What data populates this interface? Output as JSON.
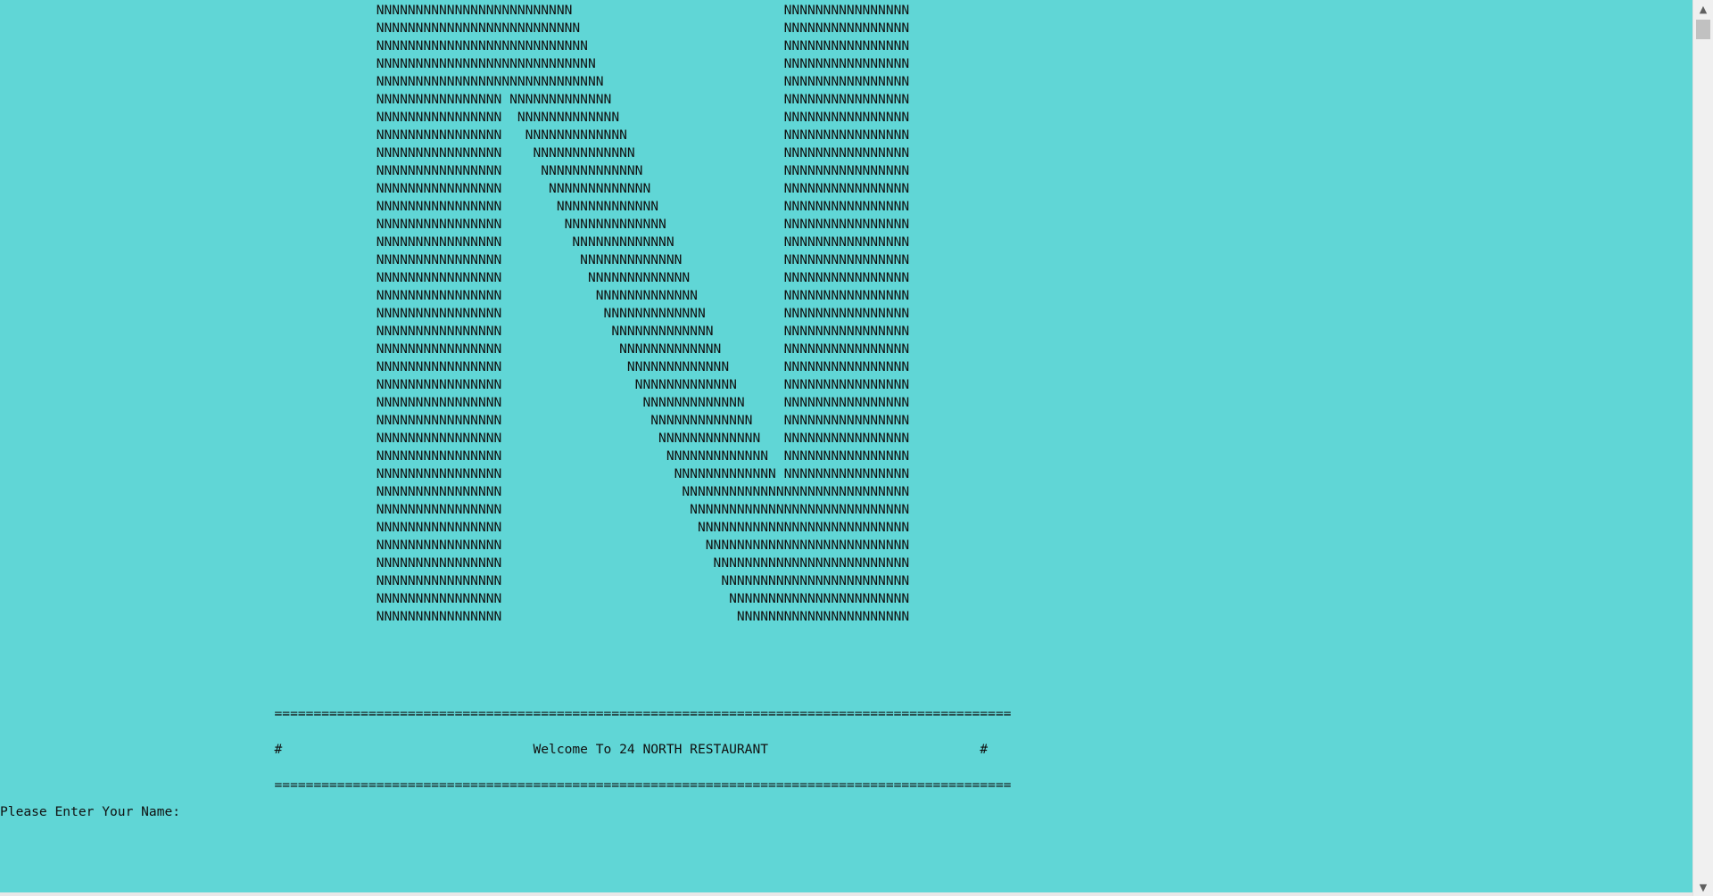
{
  "console": {
    "art_lines": [
      "                                                NNNNNNNNNNNNNNNNNNNNNNNNN                           NNNNNNNNNNNNNNNN",
      "                                                NNNNNNNNNNNNNNNNNNNNNNNNNN                          NNNNNNNNNNNNNNNN",
      "                                                NNNNNNNNNNNNNNNNNNNNNNNNNNN                         NNNNNNNNNNNNNNNN",
      "                                                NNNNNNNNNNNNNNNNNNNNNNNNNNNN                        NNNNNNNNNNNNNNNN",
      "                                                NNNNNNNNNNNNNNNNNNNNNNNNNNNNN                       NNNNNNNNNNNNNNNN",
      "                                                NNNNNNNNNNNNNNNN NNNNNNNNNNNNN                      NNNNNNNNNNNNNNNN",
      "                                                NNNNNNNNNNNNNNNN  NNNNNNNNNNNNN                     NNNNNNNNNNNNNNNN",
      "                                                NNNNNNNNNNNNNNNN   NNNNNNNNNNNNN                    NNNNNNNNNNNNNNNN",
      "                                                NNNNNNNNNNNNNNNN    NNNNNNNNNNNNN                   NNNNNNNNNNNNNNNN",
      "                                                NNNNNNNNNNNNNNNN     NNNNNNNNNNNNN                  NNNNNNNNNNNNNNNN",
      "                                                NNNNNNNNNNNNNNNN      NNNNNNNNNNNNN                 NNNNNNNNNNNNNNNN",
      "                                                NNNNNNNNNNNNNNNN       NNNNNNNNNNNNN                NNNNNNNNNNNNNNNN",
      "                                                NNNNNNNNNNNNNNNN        NNNNNNNNNNNNN               NNNNNNNNNNNNNNNN",
      "                                                NNNNNNNNNNNNNNNN         NNNNNNNNNNNNN              NNNNNNNNNNNNNNNN",
      "                                                NNNNNNNNNNNNNNNN          NNNNNNNNNNNNN             NNNNNNNNNNNNNNNN",
      "                                                NNNNNNNNNNNNNNNN           NNNNNNNNNNNNN            NNNNNNNNNNNNNNNN",
      "                                                NNNNNNNNNNNNNNNN            NNNNNNNNNNNNN           NNNNNNNNNNNNNNNN",
      "                                                NNNNNNNNNNNNNNNN             NNNNNNNNNNNNN          NNNNNNNNNNNNNNNN",
      "                                                NNNNNNNNNNNNNNNN              NNNNNNNNNNNNN         NNNNNNNNNNNNNNNN",
      "                                                NNNNNNNNNNNNNNNN               NNNNNNNNNNNNN        NNNNNNNNNNNNNNNN",
      "                                                NNNNNNNNNNNNNNNN                NNNNNNNNNNNNN       NNNNNNNNNNNNNNNN",
      "                                                NNNNNNNNNNNNNNNN                 NNNNNNNNNNNNN      NNNNNNNNNNNNNNNN",
      "                                                NNNNNNNNNNNNNNNN                  NNNNNNNNNNNNN     NNNNNNNNNNNNNNNN",
      "                                                NNNNNNNNNNNNNNNN                   NNNNNNNNNNNNN    NNNNNNNNNNNNNNNN",
      "                                                NNNNNNNNNNNNNNNN                    NNNNNNNNNNNNN   NNNNNNNNNNNNNNNN",
      "                                                NNNNNNNNNNNNNNNN                     NNNNNNNNNNNNN  NNNNNNNNNNNNNNNN",
      "                                                NNNNNNNNNNNNNNNN                      NNNNNNNNNNNNN NNNNNNNNNNNNNNNN",
      "                                                NNNNNNNNNNNNNNNN                       NNNNNNNNNNNNNNNNNNNNNNNNNNNNN",
      "                                                NNNNNNNNNNNNNNNN                        NNNNNNNNNNNNNNNNNNNNNNNNNNNN",
      "                                                NNNNNNNNNNNNNNNN                         NNNNNNNNNNNNNNNNNNNNNNNNNNN",
      "                                                NNNNNNNNNNNNNNNN                          NNNNNNNNNNNNNNNNNNNNNNNNNN",
      "                                                NNNNNNNNNNNNNNNN                           NNNNNNNNNNNNNNNNNNNNNNNNN",
      "                                                NNNNNNNNNNNNNNNN                            NNNNNNNNNNNNNNNNNNNNNNNN",
      "                                                NNNNNNNNNNNNNNNN                             NNNNNNNNNNNNNNNNNNNNNNN",
      "                                                NNNNNNNNNNNNNNNN                              NNNNNNNNNNNNNNNNNNNNNN"
    ],
    "banner_rule": "                                   ==============================================================================================",
    "banner_title": "                                   #                                Welcome To 24 NORTH RESTAURANT                           #",
    "prompt_label": "Please Enter Your Name: ",
    "prompt_value": ""
  },
  "scrollbar": {
    "up_arrow": "▲",
    "down_arrow": "▼"
  },
  "colors": {
    "background": "#60d6d6",
    "text": "#101010"
  }
}
